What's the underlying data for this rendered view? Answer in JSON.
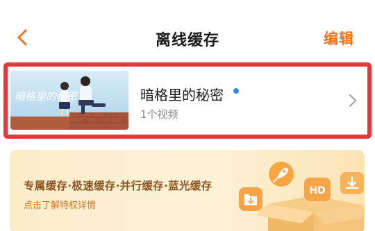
{
  "header": {
    "back_icon": "chevron-left-icon",
    "title": "离线缓存",
    "edit_label": "编辑"
  },
  "cache_item": {
    "title": "暗格里的秘密",
    "thumbnail_text": "暗格里的秘密",
    "count": "1个视频",
    "new_dot_color": "#2f8cf5",
    "arrow_icon": "chevron-right-icon",
    "highlight_color": "#e8373a"
  },
  "promo": {
    "title": "专属缓存·极速缓存·并行缓存·蓝光缓存",
    "subtitle": "点击了解特权详情",
    "hd_badge": "HD",
    "icons": [
      "rocket-icon",
      "hd-icon",
      "download-icon",
      "folder-download-icon",
      "box-icon"
    ]
  },
  "colors": {
    "accent": "#f2731d",
    "banner_title": "#8b5421",
    "banner_sub": "#d27a2c"
  }
}
